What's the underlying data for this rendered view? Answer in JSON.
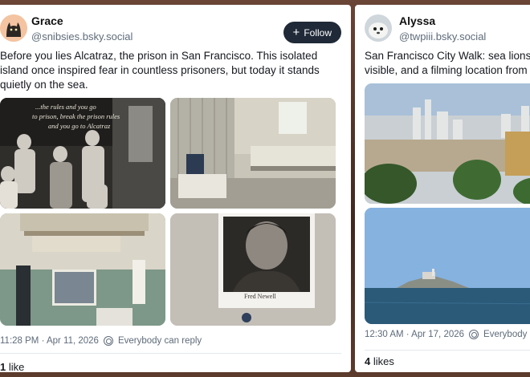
{
  "post1": {
    "author_name": "Grace",
    "author_handle": "@snibsies.bsky.social",
    "follow_label": "Follow",
    "text": "Before you lies Alcatraz, the prison in San Francisco. This isolated island once inspired fear in countless prisoners, but today it stands quietly on the sea.",
    "photo1_caption": "...the rules and you go to prison, break the prison rules and you go to Alcatraz",
    "photo4_caption": "Fred Newell",
    "timestamp": "11:28 PM · Apr 11, 2026",
    "reply_setting": "Everybody can reply",
    "like_count": "1",
    "like_label": "like"
  },
  "post2": {
    "author_name": "Alyssa",
    "author_handle": "@twpiii.bsky.social",
    "text": "San Francisco City Walk: sea lions visible, and a filming location from",
    "timestamp": "12:30 AM · Apr 17, 2026",
    "reply_setting": "Everybody can reply",
    "like_count": "4",
    "like_label": "likes"
  },
  "colors": {
    "background": "#5a3a2c",
    "card": "#ffffff",
    "follow_button": "#1f2937",
    "secondary_text": "#5e6b7a"
  },
  "icons": [
    "cat-avatar",
    "seal-avatar",
    "plus-icon",
    "globe-icon"
  ]
}
